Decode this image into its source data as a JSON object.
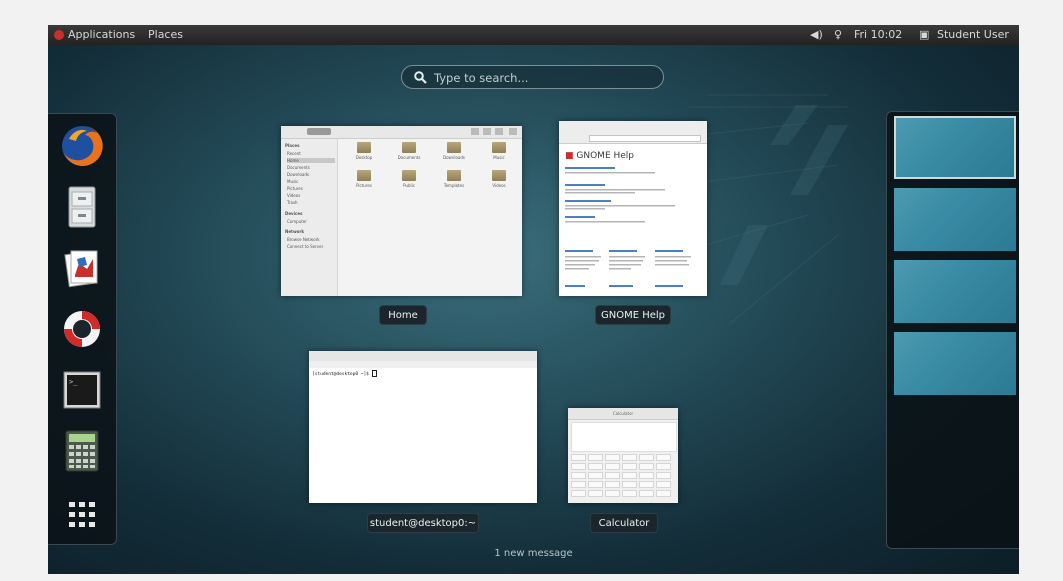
{
  "topbar": {
    "applications": "Applications",
    "places": "Places",
    "clock": "Fri 10:02",
    "user": "Student User"
  },
  "search": {
    "placeholder": "Type to search..."
  },
  "dock": {
    "apps": [
      "firefox-icon",
      "file-cabinet-icon",
      "documents-icon",
      "help-lifebuoy-icon",
      "terminal-icon",
      "calculator-icon",
      "app-grid-icon"
    ]
  },
  "windows": {
    "home": {
      "label": "Home",
      "sidebar_places": "Places",
      "sidebar_items": [
        "Recent",
        "Home",
        "Documents",
        "Downloads",
        "Music",
        "Pictures",
        "Videos",
        "Trash"
      ],
      "sidebar_devices": "Devices",
      "sidebar_device_items": [
        "Computer"
      ],
      "sidebar_network": "Network",
      "sidebar_network_items": [
        "Browse Network",
        "Connect to Server"
      ],
      "folders": [
        "Desktop",
        "Documents",
        "Downloads",
        "Music",
        "Pictures",
        "Public",
        "Templates",
        "Videos"
      ]
    },
    "help": {
      "label": "GNOME Help",
      "heading": "GNOME Help"
    },
    "terminal": {
      "label": "student@desktop0:~",
      "prompt": "[student@desktop0 ~]$ "
    },
    "calculator": {
      "label": "Calculator",
      "title": "Calculator"
    }
  },
  "workspaces": {
    "count": 4,
    "active": 0
  },
  "notification": {
    "message": "1 new message"
  }
}
